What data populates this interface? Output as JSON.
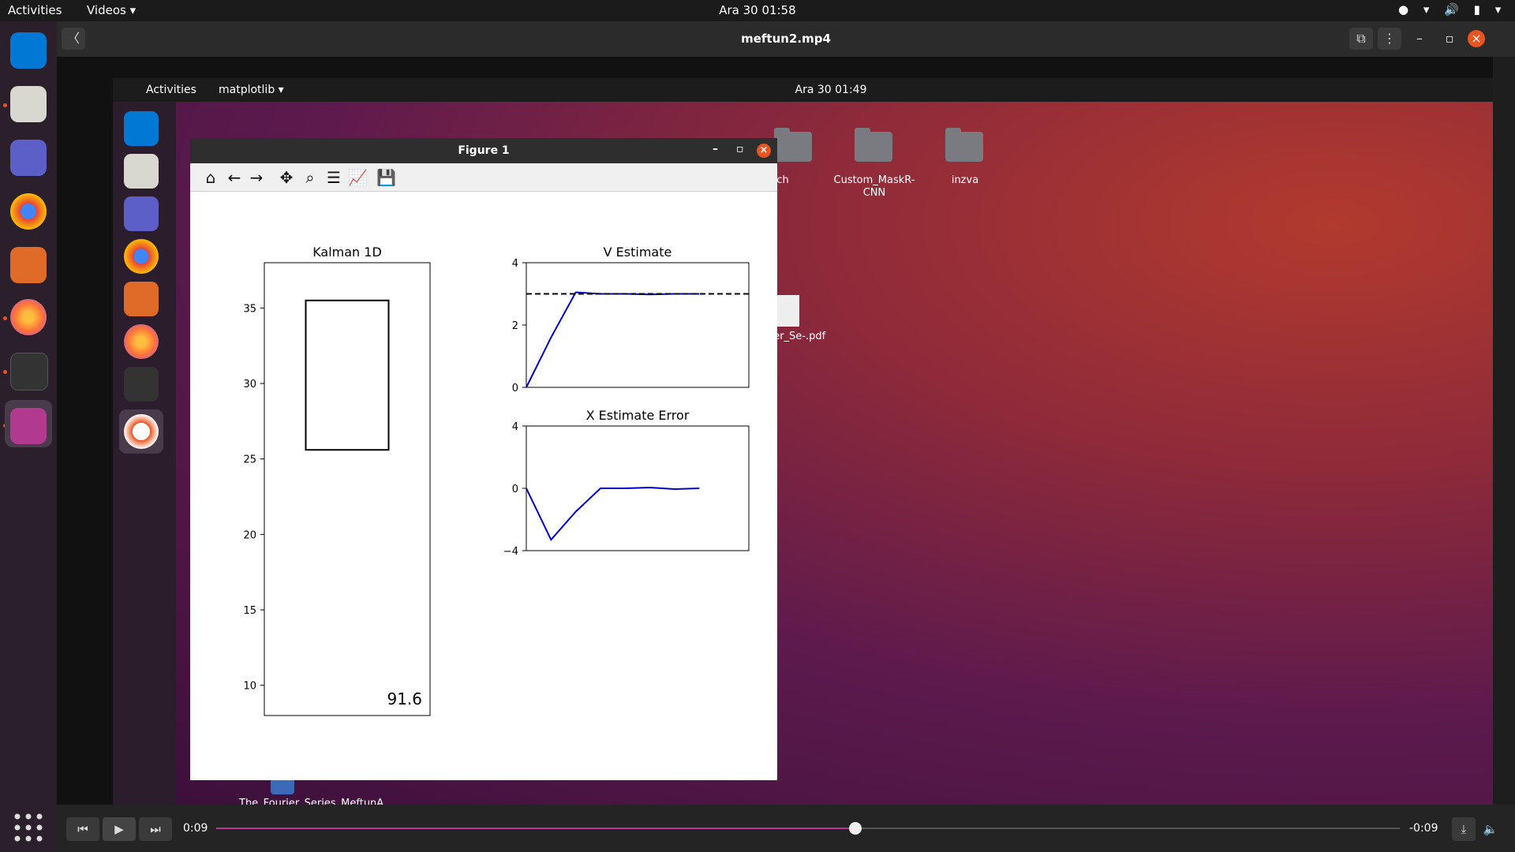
{
  "outer_topbar": {
    "activities": "Activities",
    "app_menu": "Videos ▾",
    "clock": "Ara 30  01:58"
  },
  "player": {
    "title": "meftun2.mp4",
    "elapsed": "0:09",
    "remaining": "-0:09",
    "progress_fraction": 0.54
  },
  "inner_topbar": {
    "activities": "Activities",
    "app_menu": "matplotlib ▾",
    "clock": "Ara 30  01:49"
  },
  "desktop_icons": [
    {
      "label": "ech"
    },
    {
      "label": "Custom_MaskR-CNN"
    },
    {
      "label": "inzva"
    },
    {
      "label": "urier_Se-.pdf"
    },
    {
      "label": "The_Fourier_Series_MeftunA..."
    }
  ],
  "figure_window": {
    "title": "Figure 1"
  },
  "chart_data": [
    {
      "type": "bar",
      "title": "Kalman 1D",
      "ylim": [
        8,
        38
      ],
      "yticks": [
        10,
        15,
        20,
        25,
        30,
        35
      ],
      "box": {
        "low": 25.6,
        "high": 35.5
      },
      "annotation": "91.6"
    },
    {
      "type": "line",
      "title": "V Estimate",
      "ylim": [
        0,
        4
      ],
      "yticks": [
        0,
        2,
        4
      ],
      "series": [
        {
          "color": "#0000cc",
          "style": "solid",
          "x": [
            0,
            1,
            2,
            3,
            4,
            5,
            6,
            7
          ],
          "y": [
            0,
            1.6,
            3.05,
            3.0,
            3.0,
            2.98,
            3.0,
            3.0
          ]
        },
        {
          "color": "#000000",
          "style": "dashed",
          "x": [
            0,
            9
          ],
          "y": [
            3.0,
            3.0
          ]
        }
      ],
      "xlim": [
        0,
        9
      ]
    },
    {
      "type": "line",
      "title": "X Estimate Error",
      "ylim": [
        -4,
        4
      ],
      "yticks": [
        -4,
        0,
        4
      ],
      "series": [
        {
          "color": "#0000cc",
          "style": "solid",
          "x": [
            0,
            1,
            2,
            3,
            4,
            5,
            6,
            7
          ],
          "y": [
            0,
            -3.3,
            -1.5,
            0,
            0,
            0.05,
            -0.05,
            0
          ]
        }
      ],
      "xlim": [
        0,
        9
      ]
    }
  ]
}
